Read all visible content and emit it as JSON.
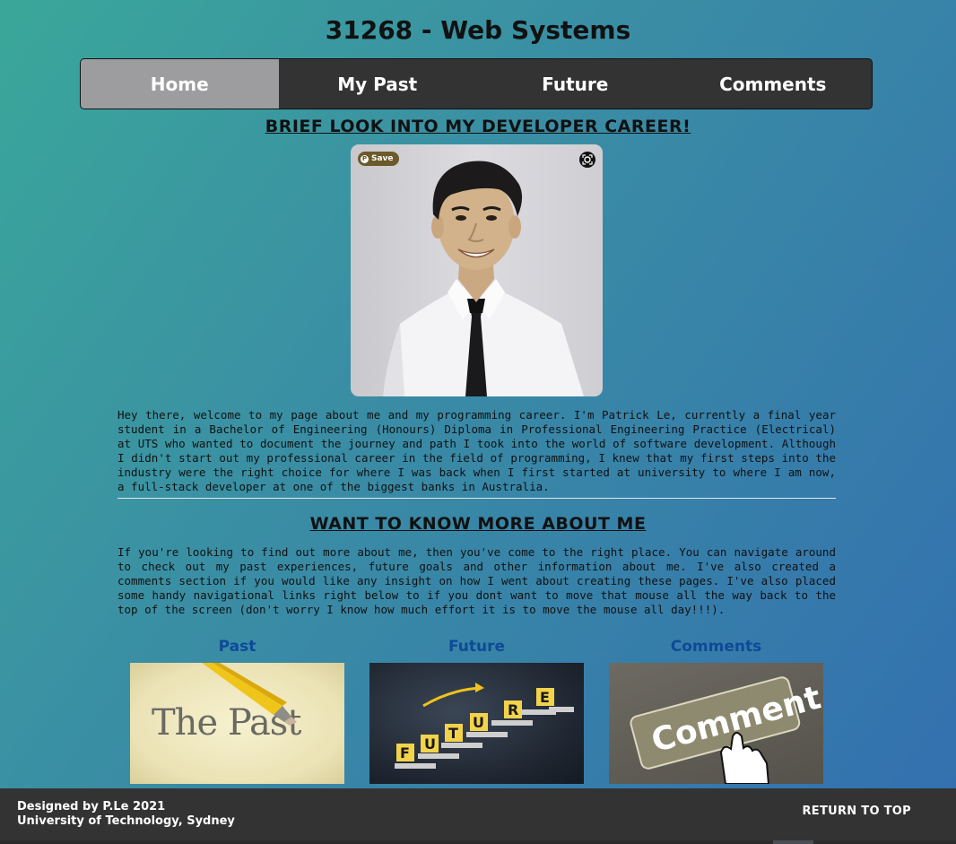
{
  "header": {
    "title": "31268 - Web Systems"
  },
  "nav": {
    "items": [
      {
        "label": "Home"
      },
      {
        "label": "My Past"
      },
      {
        "label": "Future"
      },
      {
        "label": "Comments"
      }
    ],
    "active_index": 0
  },
  "intro": {
    "heading": "BRIEF LOOK INTO MY DEVELOPER CAREER!",
    "photo_save_label": "Save",
    "paragraph": "Hey there, welcome to my page about me and my programming career. I'm Patrick Le, currently a final year student in a Bachelor of Engineering (Honours) Diploma in Professional Engineering Practice (Electrical) at UTS who wanted to document the journey and path I took into the world of software development. Although I didn't start out my professional career in the field of programming, I knew that my first steps into the industry were the right choice for where I was back when I first started at university to where I am now, a full-stack developer at one of the biggest banks in Australia."
  },
  "about": {
    "heading": "WANT TO KNOW MORE ABOUT ME",
    "paragraph": "If you're looking to find out more about me, then you've come to the right place. You can navigate around to check out my past experiences, future goals and other information about me. I've also created a comments section if you would like any insight on how I went about creating these pages. I've also placed some handy navigational links right below to if you dont want to move that mouse all the way back to the top of the screen (don't worry I know how much effort it is to move the mouse all day!!!)."
  },
  "cards": [
    {
      "title": "Past",
      "image_text": "The Past"
    },
    {
      "title": "Future",
      "image_text": "FUTURE"
    },
    {
      "title": "Comments",
      "image_text": "Comment"
    }
  ],
  "footer": {
    "designed_by": "Designed by P.Le 2021",
    "university": "University of Technology, Sydney",
    "return_label": "RETURN TO TOP"
  },
  "colors": {
    "nav_bg": "#333333",
    "nav_active": "#9d9d9f",
    "card_title": "#0e4a97",
    "footer_bg": "#333333"
  }
}
